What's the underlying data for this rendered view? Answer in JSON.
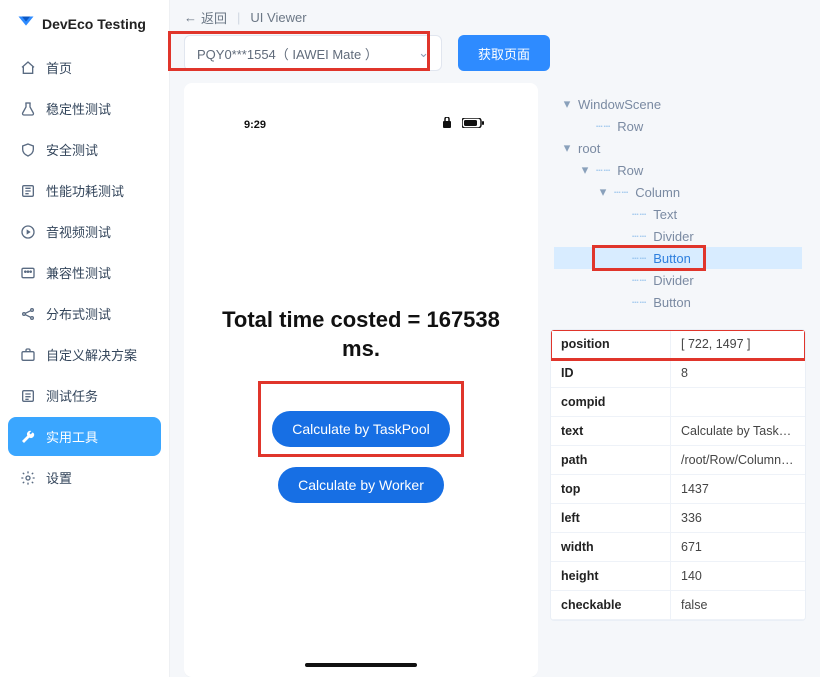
{
  "brand": {
    "name": "DevEco Testing"
  },
  "sidebar": {
    "items": [
      {
        "label": "首页",
        "icon": "home-icon",
        "active": false
      },
      {
        "label": "稳定性测试",
        "icon": "beaker-icon",
        "active": false
      },
      {
        "label": "安全测试",
        "icon": "shield-icon",
        "active": false
      },
      {
        "label": "性能功耗测试",
        "icon": "gauge-icon",
        "active": false
      },
      {
        "label": "音视频测试",
        "icon": "play-icon",
        "active": false
      },
      {
        "label": "兼容性测试",
        "icon": "grid-icon",
        "active": false
      },
      {
        "label": "分布式测试",
        "icon": "share-icon",
        "active": false
      },
      {
        "label": "自定义解决方案",
        "icon": "briefcase-icon",
        "active": false
      },
      {
        "label": "测试任务",
        "icon": "list-icon",
        "active": false
      },
      {
        "label": "实用工具",
        "icon": "tool-icon",
        "active": true
      },
      {
        "label": "设置",
        "icon": "gear-icon",
        "active": false
      }
    ]
  },
  "topbar": {
    "back": "返回",
    "title": "UI Viewer"
  },
  "toolbar": {
    "device_selected": "PQY0***1554（ IAWEI Mate ）",
    "fetch_label": "获取页面"
  },
  "preview": {
    "status": {
      "time": "9:29"
    },
    "main_text": "Total time costed = 167538 ms.",
    "btn1": "Calculate by TaskPool",
    "btn2": "Calculate by Worker"
  },
  "tree": {
    "nodes": [
      {
        "depth": 0,
        "glyph": "▾",
        "label": "WindowScene",
        "sel": false,
        "dash": false
      },
      {
        "depth": 1,
        "glyph": "",
        "label": "Row",
        "sel": false,
        "dash": true
      },
      {
        "depth": 0,
        "glyph": "▾",
        "label": "root",
        "sel": false,
        "dash": false
      },
      {
        "depth": 1,
        "glyph": "▾",
        "label": "Row",
        "sel": false,
        "dash": true
      },
      {
        "depth": 2,
        "glyph": "▾",
        "label": "Column",
        "sel": false,
        "dash": true
      },
      {
        "depth": 3,
        "glyph": "",
        "label": "Text",
        "sel": false,
        "dash": true
      },
      {
        "depth": 3,
        "glyph": "",
        "label": "Divider",
        "sel": false,
        "dash": true
      },
      {
        "depth": 3,
        "glyph": "",
        "label": "Button",
        "sel": true,
        "dash": true
      },
      {
        "depth": 3,
        "glyph": "",
        "label": "Divider",
        "sel": false,
        "dash": true
      },
      {
        "depth": 3,
        "glyph": "",
        "label": "Button",
        "sel": false,
        "dash": true
      }
    ]
  },
  "props": [
    {
      "key": "position",
      "val": "[ 722, 1497 ]"
    },
    {
      "key": "ID",
      "val": "8"
    },
    {
      "key": "compid",
      "val": ""
    },
    {
      "key": "text",
      "val": "Calculate by TaskPool"
    },
    {
      "key": "path",
      "val": "/root/Row/Column/Bu"
    },
    {
      "key": "top",
      "val": "1437"
    },
    {
      "key": "left",
      "val": "336"
    },
    {
      "key": "width",
      "val": "671"
    },
    {
      "key": "height",
      "val": "140"
    },
    {
      "key": "checkable",
      "val": "false"
    }
  ],
  "colors": {
    "accent": "#2e8bff",
    "highlight": "#e0352b"
  }
}
